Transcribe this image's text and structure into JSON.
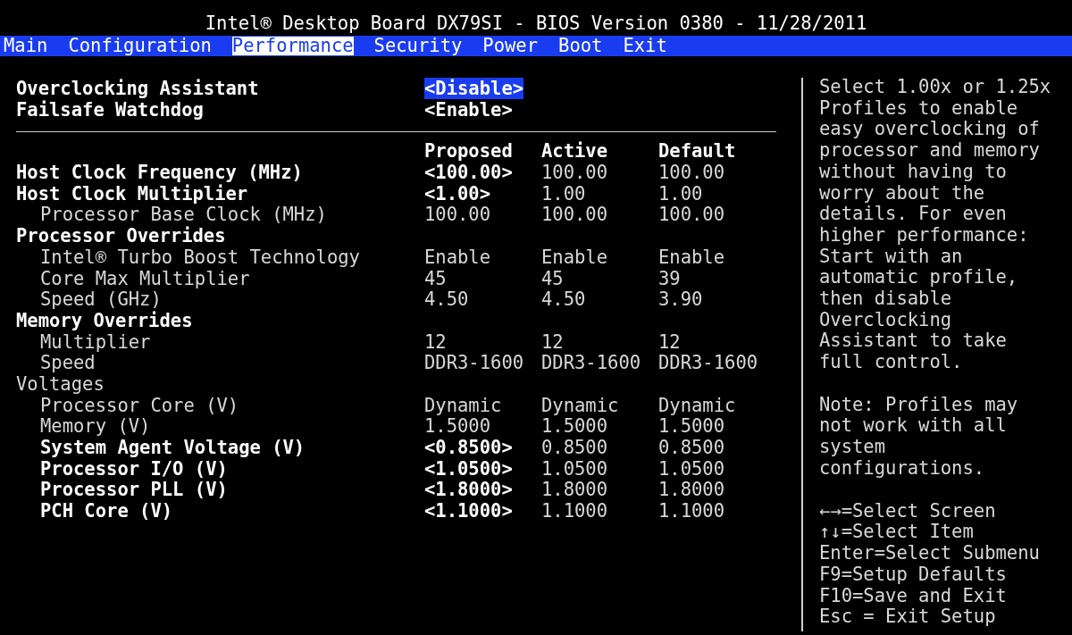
{
  "title": "Intel® Desktop Board DX79SI - BIOS Version 0380 - 11/28/2011",
  "tabs": [
    {
      "label": "Main",
      "selected": false
    },
    {
      "label": "Configuration",
      "selected": false
    },
    {
      "label": "Performance",
      "selected": true
    },
    {
      "label": "Security",
      "selected": false
    },
    {
      "label": "Power",
      "selected": false
    },
    {
      "label": "Boot",
      "selected": false
    },
    {
      "label": "Exit",
      "selected": false
    }
  ],
  "settings": [
    {
      "label": "Overclocking Assistant",
      "value": "<Disable>",
      "selected": true
    },
    {
      "label": "Failsafe Watchdog",
      "value": "<Enable>",
      "selected": false
    }
  ],
  "columns": [
    "Proposed",
    "Active",
    "Default"
  ],
  "rows": [
    {
      "label": "Host Clock Frequency (MHz)",
      "editable": true,
      "values": [
        "<100.00>",
        "100.00",
        "100.00"
      ]
    },
    {
      "label": "Host Clock Multiplier",
      "editable": true,
      "values": [
        "<1.00>",
        "1.00",
        "1.00"
      ],
      "children": [
        {
          "label": "Processor Base Clock (MHz)",
          "editable": false,
          "values": [
            "100.00",
            "100.00",
            "100.00"
          ]
        }
      ]
    },
    {
      "label": "Processor Overrides",
      "editable": true,
      "children": [
        {
          "label": "Intel® Turbo Boost Technology",
          "editable": false,
          "values": [
            "Enable",
            "Enable",
            "Enable"
          ]
        },
        {
          "label": "Core Max Multiplier",
          "editable": false,
          "values": [
            "45",
            "45",
            "39"
          ]
        },
        {
          "label": "Speed (GHz)",
          "editable": false,
          "values": [
            "4.50",
            "4.50",
            "3.90"
          ]
        }
      ]
    },
    {
      "label": "Memory Overrides",
      "editable": true,
      "children": [
        {
          "label": "Multiplier",
          "editable": false,
          "values": [
            "12",
            "12",
            "12"
          ]
        },
        {
          "label": "Speed",
          "editable": false,
          "values": [
            "DDR3-1600",
            "DDR3-1600",
            "DDR3-1600"
          ]
        }
      ]
    },
    {
      "label": "Voltages",
      "editable": false,
      "children": [
        {
          "label": "Processor Core (V)",
          "editable": false,
          "values": [
            "Dynamic",
            "Dynamic",
            "Dynamic"
          ]
        },
        {
          "label": "Memory (V)",
          "editable": false,
          "values": [
            "1.5000",
            "1.5000",
            "1.5000"
          ]
        },
        {
          "label": "System Agent Voltage (V)",
          "editable": true,
          "values": [
            "<0.8500>",
            "0.8500",
            "0.8500"
          ]
        },
        {
          "label": "Processor I/O (V)",
          "editable": true,
          "values": [
            "<1.0500>",
            "1.0500",
            "1.0500"
          ]
        },
        {
          "label": "Processor PLL (V)",
          "editable": true,
          "values": [
            "<1.8000>",
            "1.8000",
            "1.8000"
          ]
        },
        {
          "label": "PCH Core (V)",
          "editable": true,
          "values": [
            "<1.1000>",
            "1.1000",
            "1.1000"
          ]
        }
      ]
    }
  ],
  "help": [
    "Select 1.00x or 1.25x Profiles to enable easy overclocking of processor and memory without having to worry about the details. For even higher performance: Start with an automatic profile, then disable Overclocking Assistant to take full control.",
    "Note: Profiles may not work with all system configurations."
  ],
  "keys": [
    "←→=Select Screen",
    "↑↓=Select Item",
    "Enter=Select Submenu",
    "F9=Setup Defaults",
    "F10=Save and Exit",
    "Esc = Exit Setup"
  ]
}
